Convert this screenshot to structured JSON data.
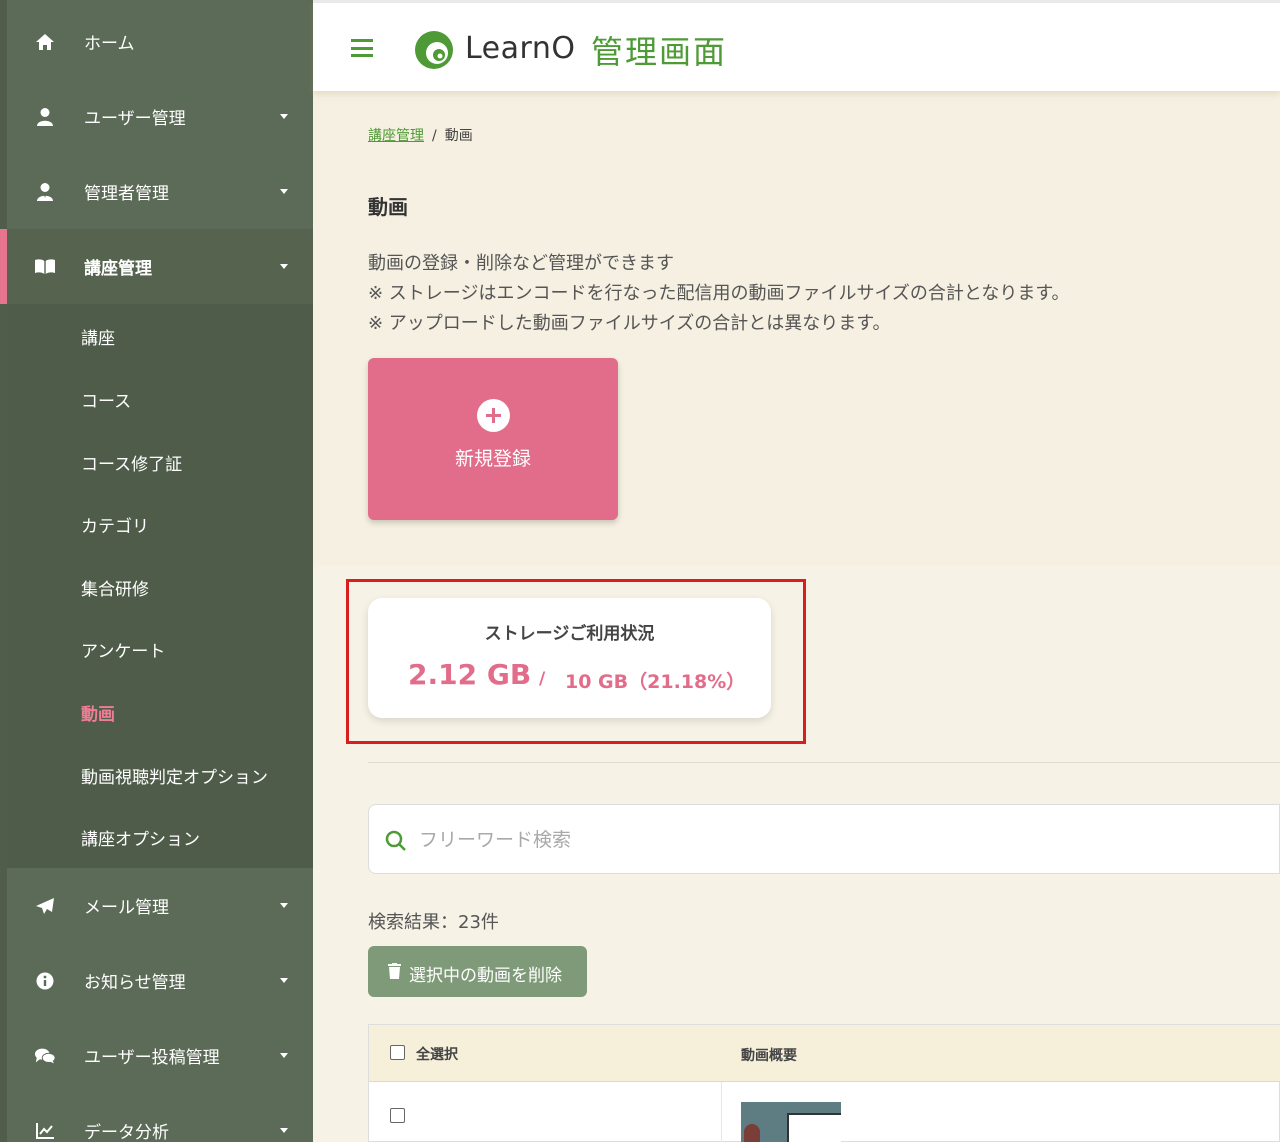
{
  "sidebar": {
    "items": [
      {
        "label": "ホーム",
        "icon": "home-icon",
        "has_caret": false
      },
      {
        "label": "ユーザー管理",
        "icon": "user-icon",
        "has_caret": true
      },
      {
        "label": "管理者管理",
        "icon": "admin-icon",
        "has_caret": true
      },
      {
        "label": "講座管理",
        "icon": "book-icon",
        "has_caret": true,
        "active": true
      },
      {
        "label": "メール管理",
        "icon": "paper-plane-icon",
        "has_caret": true
      },
      {
        "label": "お知らせ管理",
        "icon": "info-icon",
        "has_caret": true
      },
      {
        "label": "ユーザー投稿管理",
        "icon": "comments-icon",
        "has_caret": true
      },
      {
        "label": "データ分析",
        "icon": "chart-icon",
        "has_caret": true
      }
    ],
    "sub_items": [
      {
        "label": "講座"
      },
      {
        "label": "コース"
      },
      {
        "label": "コース修了証"
      },
      {
        "label": "カテゴリ"
      },
      {
        "label": "集合研修"
      },
      {
        "label": "アンケート"
      },
      {
        "label": "動画",
        "current": true
      },
      {
        "label": "動画視聴判定オプション"
      },
      {
        "label": "講座オプション"
      }
    ]
  },
  "header": {
    "logo_text": "LearnO",
    "admin_text": "管理画面"
  },
  "breadcrumb": {
    "parent": "講座管理",
    "separator": "/",
    "current": "動画"
  },
  "page": {
    "title": "動画",
    "description": [
      "動画の登録・削除など管理ができます",
      "※ ストレージはエンコードを行なった配信用の動画ファイルサイズの合計となります。",
      "※ アップロードした動画ファイルサイズの合計とは異なります。"
    ],
    "new_button_label": "新規登録"
  },
  "storage": {
    "title": "ストレージご利用状況",
    "used": "2.12 GB",
    "slash": "/",
    "total": "10 GB（21.18%）"
  },
  "search": {
    "placeholder": "フリーワード検索"
  },
  "results": {
    "count_text": "検索結果：23件",
    "delete_button_label": "選択中の動画を削除"
  },
  "table": {
    "select_all_label": "全選択",
    "summary_header": "動画概要"
  },
  "colors": {
    "sidebar_bg": "#5c6b57",
    "accent_green": "#4e9a36",
    "accent_pink": "#e26d8a",
    "highlight_red": "#d81e1e"
  }
}
